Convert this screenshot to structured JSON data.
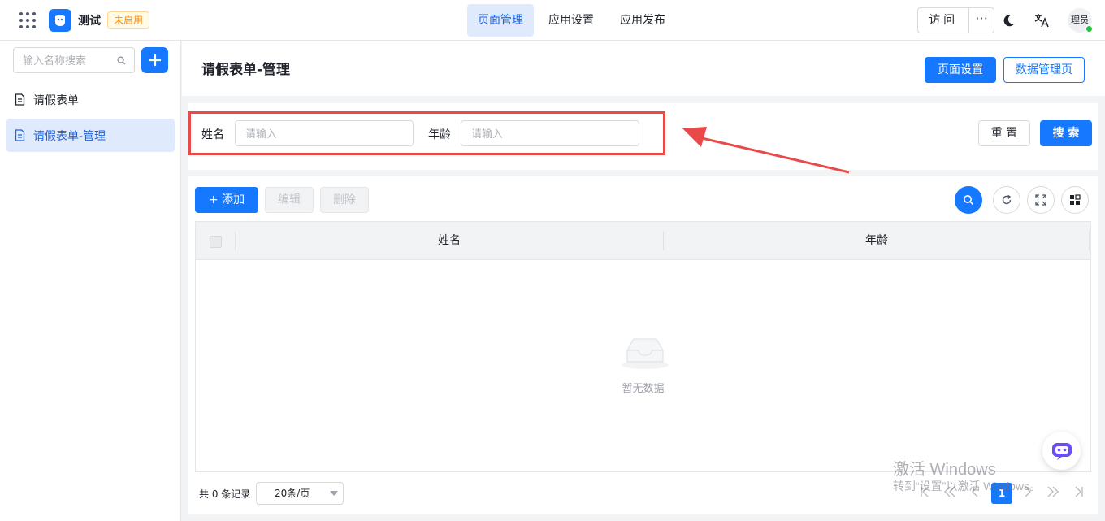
{
  "topbar": {
    "app_name": "测试",
    "app_status": "未启用",
    "nav_tabs": [
      "页面管理",
      "应用设置",
      "应用发布"
    ],
    "visit_label": "访问",
    "more_label": "···",
    "avatar_text": "理员"
  },
  "sidebar": {
    "search_placeholder": "输入名称搜索",
    "items": [
      {
        "label": "请假表单",
        "active": false
      },
      {
        "label": "请假表单-管理",
        "active": true
      }
    ]
  },
  "header": {
    "title": "请假表单-管理",
    "page_settings_label": "页面设置",
    "data_manage_label": "数据管理页"
  },
  "filter": {
    "fields": [
      {
        "label": "姓名",
        "placeholder": "请输入"
      },
      {
        "label": "年龄",
        "placeholder": "请输入"
      }
    ],
    "reset_label": "重 置",
    "search_label": "搜 索"
  },
  "toolbar": {
    "add_label": "+ 添加",
    "edit_label": "编辑",
    "delete_label": "删除"
  },
  "table": {
    "columns": [
      "姓名",
      "年龄"
    ],
    "empty_text": "暂无数据"
  },
  "pagination": {
    "total_text": "共 0 条记录",
    "page_size": "20条/页",
    "current_page": "1"
  },
  "watermark": {
    "line1": "激活 Windows",
    "line2": "转到“设置”以激活 Windows。"
  },
  "colors": {
    "primary": "#1677ff",
    "highlight": "#e84a4a",
    "warning": "#fa8c16"
  }
}
